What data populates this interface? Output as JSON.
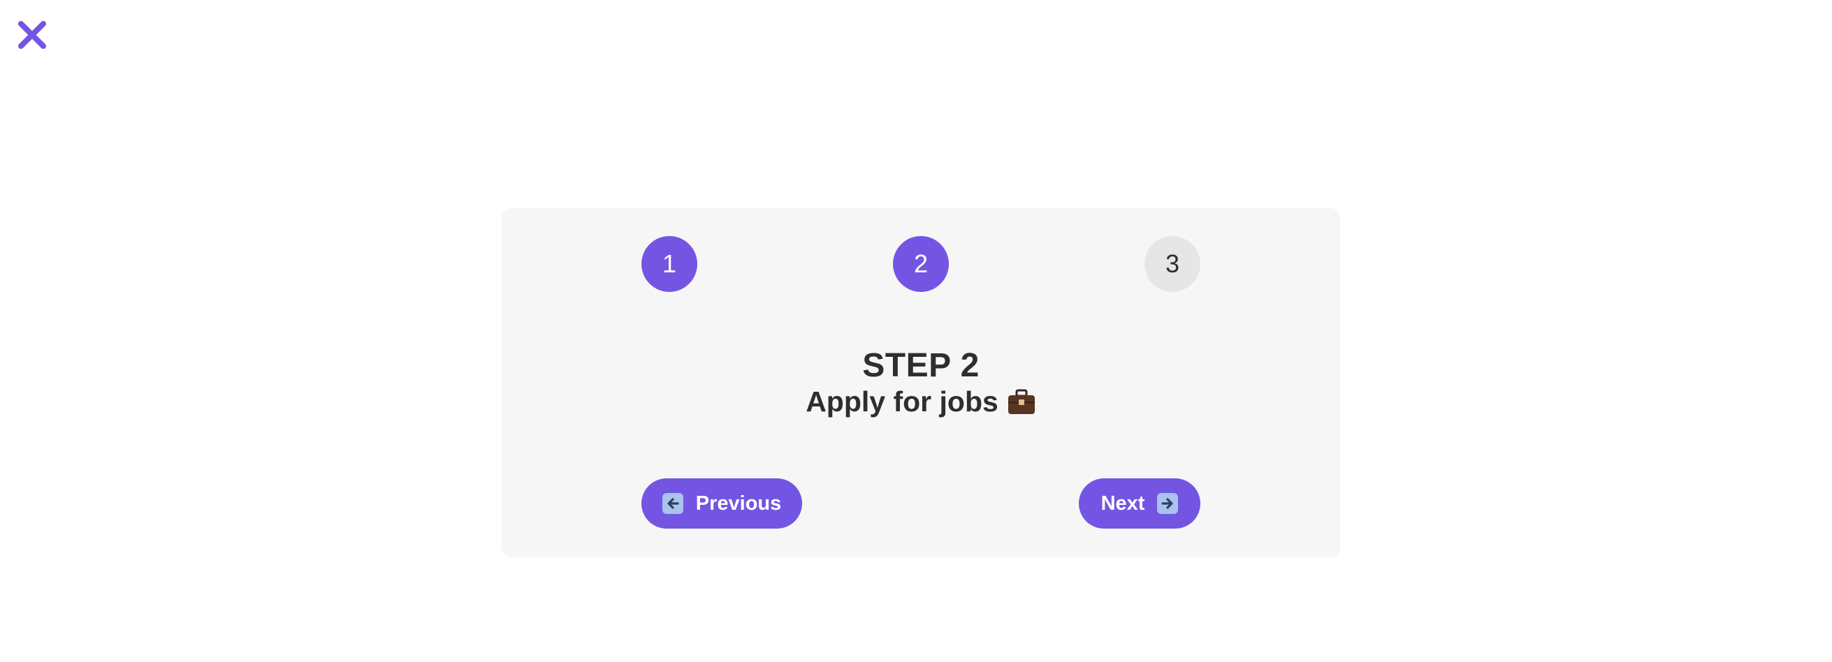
{
  "close": {
    "icon": "close-icon",
    "color": "#7455e3"
  },
  "stepper": {
    "steps": [
      {
        "label": "1",
        "state": "completed"
      },
      {
        "label": "2",
        "state": "current"
      },
      {
        "label": "3",
        "state": "upcoming"
      }
    ],
    "active_color": "#7455e3",
    "inactive_color": "#e6e6e6"
  },
  "content": {
    "title": "STEP 2",
    "subtitle": "Apply for jobs",
    "subtitle_icon": "briefcase-icon"
  },
  "nav": {
    "previous_label": "Previous",
    "previous_icon": "left-arrow-icon",
    "next_label": "Next",
    "next_icon": "right-arrow-icon"
  }
}
